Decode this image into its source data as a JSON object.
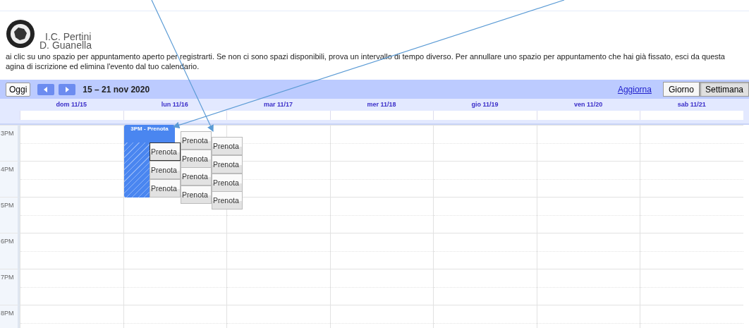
{
  "school": {
    "name_lines": [
      "I.C. Pertini",
      "D. Guanella"
    ]
  },
  "instructions": [
    "ai clic su uno spazio per appuntamento aperto per registrarti. Se non ci sono spazi disponibili, prova un intervallo di tempo diverso. Per annullare uno spazio per appuntamento che hai già fissato, esci da questa",
    "agina di iscrizione ed elimina l'evento dal tuo calendario."
  ],
  "toolbar": {
    "today": "Oggi",
    "date_range": "15 – 21 nov 2020",
    "refresh": "Aggiorna",
    "views": [
      {
        "label": "Giorno",
        "selected": false
      },
      {
        "label": "Settimana",
        "selected": true
      }
    ]
  },
  "days": [
    "dom 11/15",
    "lun 11/16",
    "mar 11/17",
    "mer 11/18",
    "gio 11/19",
    "ven 11/20",
    "sab 11/21"
  ],
  "hours": [
    "3PM",
    "4PM",
    "5PM",
    "6PM",
    "7PM",
    "8PM"
  ],
  "event": {
    "title": "3PM - Prenota",
    "slot_columns": [
      [
        {
          "label": "Prenota",
          "focused": true
        },
        {
          "label": "Prenota",
          "focused": false
        },
        {
          "label": "Prenota",
          "focused": false
        }
      ],
      [
        {
          "label": "Prenota",
          "focused": false
        },
        {
          "label": "Prenota",
          "focused": false
        },
        {
          "label": "Prenota",
          "focused": false
        },
        {
          "label": "Prenota",
          "focused": false
        }
      ],
      [
        {
          "label": "Prenota",
          "focused": false
        },
        {
          "label": "Prenota",
          "focused": false
        },
        {
          "label": "Prenota",
          "focused": false
        },
        {
          "label": "Prenota",
          "focused": false
        }
      ]
    ]
  }
}
